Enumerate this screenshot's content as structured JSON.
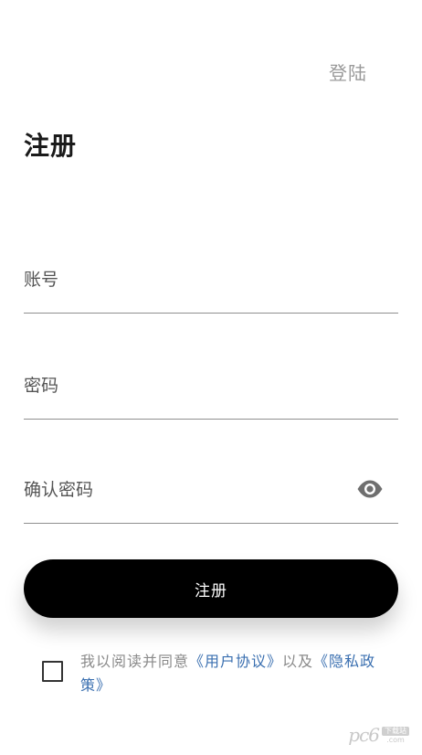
{
  "header": {
    "login_label": "登陆"
  },
  "page": {
    "title": "注册"
  },
  "form": {
    "account": {
      "placeholder": "账号",
      "value": ""
    },
    "password": {
      "placeholder": "密码",
      "value": ""
    },
    "confirm_password": {
      "placeholder": "确认密码",
      "value": "",
      "toggle_icon": "eye-icon"
    }
  },
  "actions": {
    "register_label": "注册"
  },
  "agreement": {
    "checked": false,
    "prefix": "我以阅读并同意",
    "user_agreement": "《用户协议》",
    "connector": "以及",
    "privacy_policy": "《隐私政策》"
  },
  "watermark": {
    "logo": "pc6",
    "badge_text": "下载站",
    "domain": ".com"
  },
  "colors": {
    "primary": "#000000",
    "link": "#3a6fb0",
    "muted_text": "#9a9a9a",
    "divider": "#8f8f8f"
  }
}
